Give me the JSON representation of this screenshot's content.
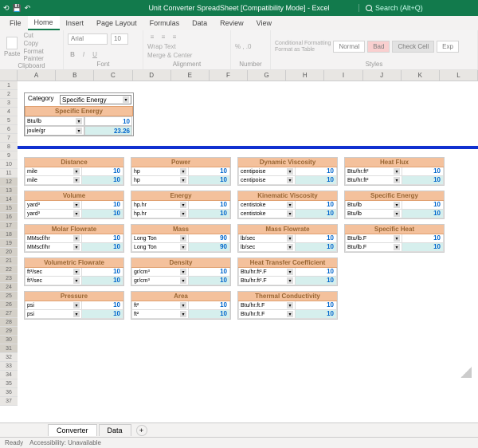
{
  "titlebar": {
    "title": "Unit Converter SpreadSheet  [Compatibility Mode]  -  Excel",
    "search_placeholder": "Search (Alt+Q)"
  },
  "menu": {
    "items": [
      "File",
      "Home",
      "Insert",
      "Page Layout",
      "Formulas",
      "Data",
      "Review",
      "View"
    ]
  },
  "ribbon": {
    "clipboard": {
      "label": "Clipboard",
      "paste": "Paste",
      "cut": "Cut",
      "copy": "Copy",
      "fp": "Format Painter"
    },
    "font": {
      "label": "Font",
      "name": "Arial",
      "size": "10",
      "bold": "B",
      "italic": "I",
      "underline": "U"
    },
    "alignment": {
      "label": "Alignment",
      "wrap": "Wrap Text",
      "merge": "Merge & Center"
    },
    "number": {
      "label": "Number"
    },
    "styles": {
      "label": "Styles",
      "cf": "Conditional Formatting",
      "fat": "Format as Table",
      "normal": "Normal",
      "bad": "Bad",
      "check": "Check Cell",
      "exp": "Exp"
    }
  },
  "cols": [
    "A",
    "B",
    "C",
    "D",
    "E",
    "F",
    "G",
    "H",
    "I",
    "J",
    "K",
    "L"
  ],
  "rows": [
    "1",
    "2",
    "3",
    "4",
    "5",
    "6",
    "7",
    "8",
    "9",
    "10",
    "11",
    "12",
    "13",
    "14",
    "15",
    "16",
    "17",
    "18",
    "19",
    "20",
    "21",
    "22",
    "23",
    "24",
    "25",
    "26",
    "27",
    "28",
    "29",
    "30",
    "31",
    "32",
    "33",
    "34",
    "35",
    "36",
    "37"
  ],
  "category": {
    "label": "Category",
    "value": "Specific Energy"
  },
  "topconv": {
    "header": "Specific Energy",
    "u1": "Btu/lb",
    "v1": "10",
    "u2": "joule/gr",
    "v2": "23.26"
  },
  "blocks": [
    [
      {
        "h": "Distance",
        "u1": "mile",
        "v1": "10",
        "u2": "mile",
        "v2": "10"
      },
      {
        "h": "Power",
        "u1": "hp",
        "v1": "10",
        "u2": "hp",
        "v2": "10"
      },
      {
        "h": "Dynamic Viscosity",
        "u1": "centipoise",
        "v1": "10",
        "u2": "centipoise",
        "v2": "10"
      },
      {
        "h": "Heat Flux",
        "u1": "Btu/hr.ft²",
        "v1": "10",
        "u2": "Btu/hr.ft²",
        "v2": "10"
      }
    ],
    [
      {
        "h": "Volume",
        "u1": "yard³",
        "v1": "10",
        "u2": "yard³",
        "v2": "10"
      },
      {
        "h": "Energy",
        "u1": "hp.hr",
        "v1": "10",
        "u2": "hp.hr",
        "v2": "10"
      },
      {
        "h": "Kinematic Viscosity",
        "u1": "centistoke",
        "v1": "10",
        "u2": "centistoke",
        "v2": "10"
      },
      {
        "h": "Specific Energy",
        "u1": "Btu/lb",
        "v1": "10",
        "u2": "Btu/lb",
        "v2": "10"
      }
    ],
    [
      {
        "h": "Molar Flowrate",
        "u1": "MMscf/hr",
        "v1": "10",
        "u2": "MMscf/hr",
        "v2": "10"
      },
      {
        "h": "Mass",
        "u1": "Long Ton",
        "v1": "90",
        "u2": "Long Ton",
        "v2": "90"
      },
      {
        "h": "Mass Flowrate",
        "u1": "lb/sec",
        "v1": "10",
        "u2": "lb/sec",
        "v2": "10"
      },
      {
        "h": "Specific Heat",
        "u1": "Btu/lb.F",
        "v1": "10",
        "u2": "Btu/lb.F",
        "v2": "10"
      }
    ],
    [
      {
        "h": "Volumetric Flowrate",
        "u1": "ft³/sec",
        "v1": "10",
        "u2": "ft³/sec",
        "v2": "10"
      },
      {
        "h": "Density",
        "u1": "gr/cm³",
        "v1": "10",
        "u2": "gr/cm³",
        "v2": "10"
      },
      {
        "h": "Heat Transfer Coefficient",
        "u1": "Btu/hr.ft².F",
        "v1": "10",
        "u2": "Btu/hr.ft².F",
        "v2": "10"
      }
    ],
    [
      {
        "h": "Pressure",
        "u1": "psi",
        "v1": "10",
        "u2": "psi",
        "v2": "10"
      },
      {
        "h": "Area",
        "u1": "ft²",
        "v1": "10",
        "u2": "ft²",
        "v2": "10"
      },
      {
        "h": "Thermal Conductivity",
        "u1": "Btu/hr.ft.F",
        "v1": "10",
        "u2": "Btu/hr.ft.F",
        "v2": "10"
      }
    ]
  ],
  "tabs": {
    "t1": "Converter",
    "t2": "Data"
  },
  "status": {
    "ready": "Ready",
    "acc": "Accessibility: Unavailable"
  }
}
